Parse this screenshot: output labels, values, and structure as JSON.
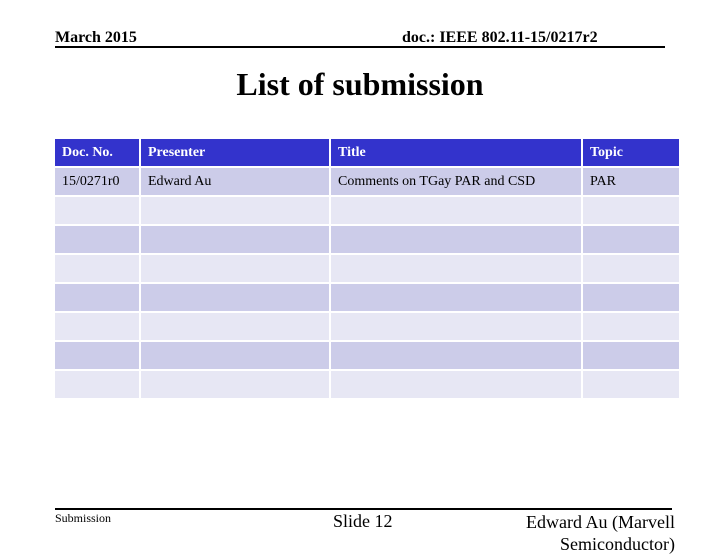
{
  "header": {
    "date": "March 2015",
    "doc_id": "doc.: IEEE 802.11-15/0217r2"
  },
  "title": "List of submission",
  "table": {
    "columns": [
      "Doc. No.",
      "Presenter",
      "Title",
      "Topic"
    ],
    "rows": [
      [
        "15/0271r0",
        "Edward Au",
        "Comments on TGay PAR and CSD",
        "PAR"
      ],
      [
        "",
        "",
        "",
        ""
      ],
      [
        "",
        "",
        "",
        ""
      ],
      [
        "",
        "",
        "",
        ""
      ],
      [
        "",
        "",
        "",
        ""
      ],
      [
        "",
        "",
        "",
        ""
      ],
      [
        "",
        "",
        "",
        ""
      ],
      [
        "",
        "",
        "",
        ""
      ]
    ]
  },
  "footer": {
    "label": "Submission",
    "slide": "Slide 12",
    "author": "Edward Au (Marvell Semiconductor)"
  },
  "colors": {
    "header_bg": "#3333cc",
    "row_dark": "#cccce9",
    "row_light": "#e7e7f4"
  }
}
